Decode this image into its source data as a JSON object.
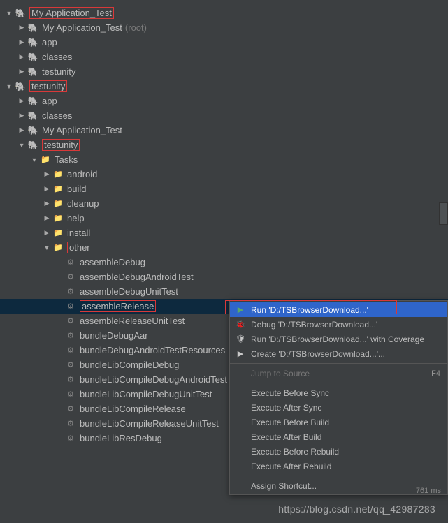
{
  "tree": [
    {
      "depth": 0,
      "arrow": "open",
      "icon": "elephant",
      "label": "My Application_Test",
      "red": true
    },
    {
      "depth": 1,
      "arrow": "closed",
      "icon": "elephant",
      "label": "My Application_Test",
      "suffix": "(root)"
    },
    {
      "depth": 1,
      "arrow": "closed",
      "icon": "elephant",
      "label": "app"
    },
    {
      "depth": 1,
      "arrow": "closed",
      "icon": "elephant",
      "label": "classes"
    },
    {
      "depth": 1,
      "arrow": "closed",
      "icon": "elephant",
      "label": "testunity"
    },
    {
      "depth": 0,
      "arrow": "open",
      "icon": "elephant",
      "label": "testunity",
      "red": true
    },
    {
      "depth": 1,
      "arrow": "closed",
      "icon": "elephant",
      "label": "app"
    },
    {
      "depth": 1,
      "arrow": "closed",
      "icon": "elephant",
      "label": "classes"
    },
    {
      "depth": 1,
      "arrow": "closed",
      "icon": "elephant",
      "label": "My Application_Test"
    },
    {
      "depth": 1,
      "arrow": "open",
      "icon": "elephant",
      "label": "testunity",
      "red": true
    },
    {
      "depth": 2,
      "arrow": "open",
      "icon": "folder",
      "label": "Tasks"
    },
    {
      "depth": 3,
      "arrow": "closed",
      "icon": "folder",
      "label": "android"
    },
    {
      "depth": 3,
      "arrow": "closed",
      "icon": "folder",
      "label": "build"
    },
    {
      "depth": 3,
      "arrow": "closed",
      "icon": "folder",
      "label": "cleanup"
    },
    {
      "depth": 3,
      "arrow": "closed",
      "icon": "folder",
      "label": "help"
    },
    {
      "depth": 3,
      "arrow": "closed",
      "icon": "folder",
      "label": "install"
    },
    {
      "depth": 3,
      "arrow": "open",
      "icon": "folder",
      "label": "other",
      "red": true
    },
    {
      "depth": 4,
      "arrow": "none",
      "icon": "gear",
      "label": "assembleDebug"
    },
    {
      "depth": 4,
      "arrow": "none",
      "icon": "gear",
      "label": "assembleDebugAndroidTest"
    },
    {
      "depth": 4,
      "arrow": "none",
      "icon": "gear",
      "label": "assembleDebugUnitTest"
    },
    {
      "depth": 4,
      "arrow": "none",
      "icon": "gear",
      "label": "assembleRelease",
      "selected": true,
      "red": true
    },
    {
      "depth": 4,
      "arrow": "none",
      "icon": "gear",
      "label": "assembleReleaseUnitTest"
    },
    {
      "depth": 4,
      "arrow": "none",
      "icon": "gear",
      "label": "bundleDebugAar"
    },
    {
      "depth": 4,
      "arrow": "none",
      "icon": "gear",
      "label": "bundleDebugAndroidTestResources"
    },
    {
      "depth": 4,
      "arrow": "none",
      "icon": "gear",
      "label": "bundleLibCompileDebug"
    },
    {
      "depth": 4,
      "arrow": "none",
      "icon": "gear",
      "label": "bundleLibCompileDebugAndroidTest"
    },
    {
      "depth": 4,
      "arrow": "none",
      "icon": "gear",
      "label": "bundleLibCompileDebugUnitTest"
    },
    {
      "depth": 4,
      "arrow": "none",
      "icon": "gear",
      "label": "bundleLibCompileRelease"
    },
    {
      "depth": 4,
      "arrow": "none",
      "icon": "gear",
      "label": "bundleLibCompileReleaseUnitTest"
    },
    {
      "depth": 4,
      "arrow": "none",
      "icon": "gear",
      "label": "bundleLibResDebug"
    }
  ],
  "contextMenu": {
    "items": [
      {
        "icon": "run",
        "label": "Run 'D:/TSBrowserDownload...'",
        "highlight": true,
        "color": "#59a869"
      },
      {
        "icon": "bug",
        "label": "Debug 'D:/TSBrowserDownload...'",
        "color": "#59a869"
      },
      {
        "icon": "coverage",
        "label": "Run 'D:/TSBrowserDownload...' with Coverage",
        "color": "#c8c8c8"
      },
      {
        "icon": "create",
        "label": "Create 'D:/TSBrowserDownload...'...",
        "color": "#c8c8c8"
      },
      {
        "sep": true
      },
      {
        "icon": "",
        "label": "Jump to Source",
        "shortcut": "F4",
        "disabled": true
      },
      {
        "sep": true
      },
      {
        "icon": "",
        "label": "Execute Before Sync"
      },
      {
        "icon": "",
        "label": "Execute After Sync"
      },
      {
        "icon": "",
        "label": "Execute Before Build"
      },
      {
        "icon": "",
        "label": "Execute After Build"
      },
      {
        "icon": "",
        "label": "Execute Before Rebuild"
      },
      {
        "icon": "",
        "label": "Execute After Rebuild"
      },
      {
        "sep": true
      },
      {
        "icon": "",
        "label": "Assign Shortcut..."
      }
    ]
  },
  "footer": {
    "line1": "761 ms"
  },
  "watermark": "https://blog.csdn.net/qq_42987283"
}
